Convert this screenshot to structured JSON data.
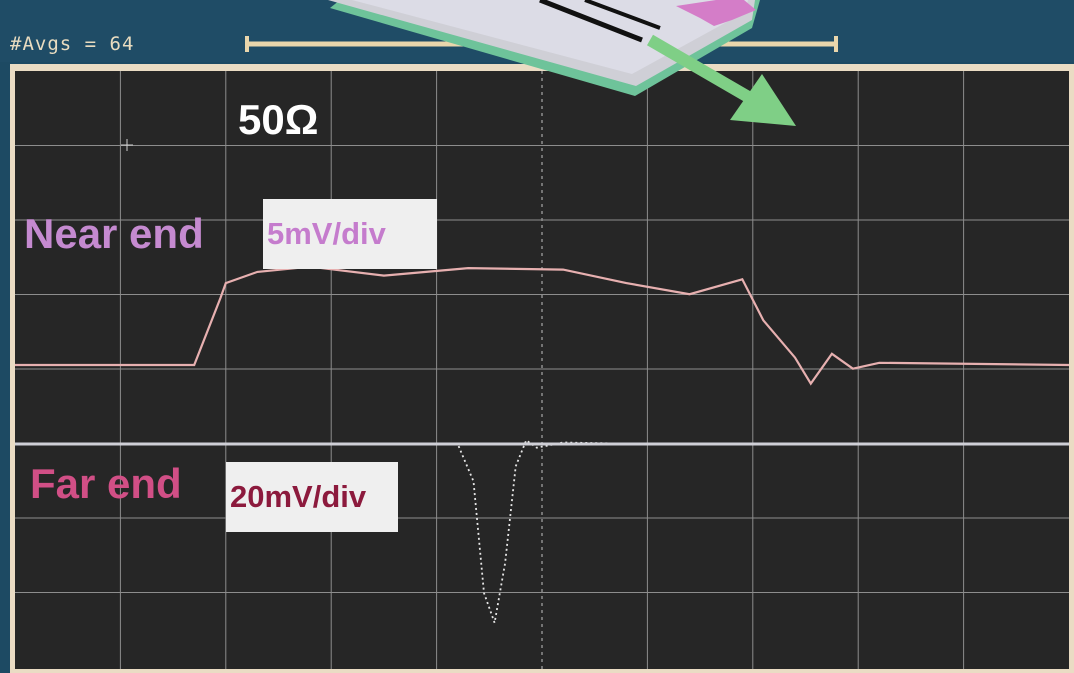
{
  "header": {
    "avgs_text": "#Avgs = 64"
  },
  "labels": {
    "impedance": "50Ω",
    "near_end": "Near end",
    "near_scale": "5mV/div",
    "far_end": "Far end",
    "far_scale": "20mV/div"
  },
  "colors": {
    "screen_bg": "#262626",
    "grid": "#8d8d8d",
    "near_trace": "#e7b0b0",
    "far_trace": "#e6e6e6",
    "near_label": "#c58ad0",
    "far_label": "#d14f86",
    "slider": "#e9d6ac",
    "arrow_green": "#7fcf86",
    "arrow_pink": "#d47dc8"
  },
  "trace_data": {
    "near_end": {
      "units_per_div": "5mV/div",
      "x_div": [
        0,
        1.7,
        1.95,
        2.0,
        2.3,
        2.8,
        3.5,
        4.3,
        5.2,
        5.8,
        6.4,
        6.9,
        7.1,
        7.4,
        7.55,
        7.75,
        7.95,
        8.2,
        10
      ],
      "y_div": [
        0,
        0,
        0.9,
        1.1,
        1.25,
        1.32,
        1.2,
        1.3,
        1.28,
        1.1,
        0.95,
        1.15,
        0.6,
        0.1,
        -0.25,
        0.15,
        -0.05,
        0.03,
        0
      ]
    },
    "far_end": {
      "units_per_div": "20mV/div",
      "x_div": [
        0,
        4.2,
        4.35,
        4.45,
        4.55,
        4.65,
        4.75,
        4.85,
        4.95,
        5.2,
        6.0,
        10
      ],
      "y_div": [
        0,
        0,
        -0.5,
        -2.0,
        -2.4,
        -1.6,
        -0.3,
        0.05,
        -0.05,
        0.02,
        0.0,
        0
      ]
    }
  }
}
